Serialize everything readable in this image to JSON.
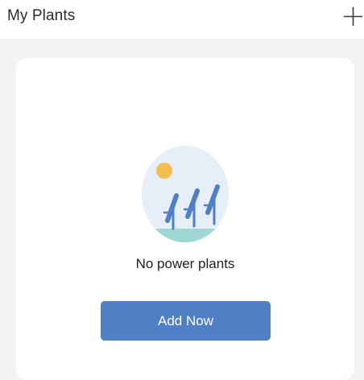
{
  "header": {
    "title": "My Plants",
    "add_icon": "plus-icon"
  },
  "empty_state": {
    "illustration_icon": "solar-panels-sun-illustration",
    "message": "No power plants",
    "button_label": "Add Now"
  },
  "colors": {
    "accent": "#4f7fc4",
    "background": "#f4f4f6",
    "card": "#ffffff",
    "sun": "#f3c04f",
    "circle": "#e6eef8",
    "ground": "#9ed7d3",
    "panel": "#4f7fc4"
  }
}
